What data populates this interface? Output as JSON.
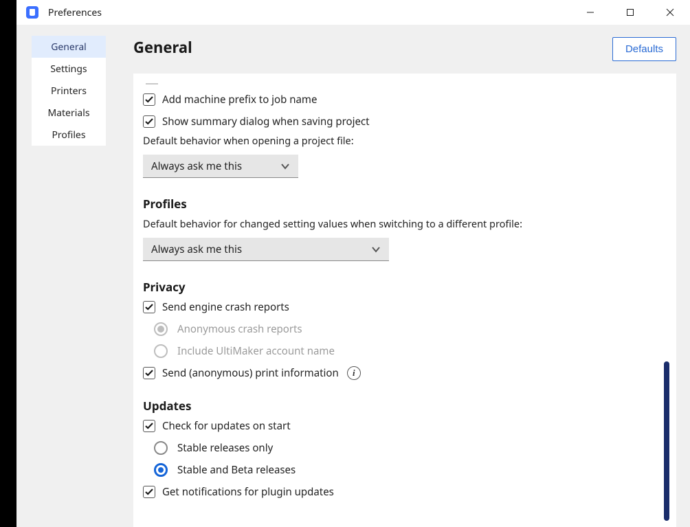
{
  "window": {
    "title": "Preferences"
  },
  "sidebar": {
    "items": [
      {
        "label": "General"
      },
      {
        "label": "Settings"
      },
      {
        "label": "Printers"
      },
      {
        "label": "Materials"
      },
      {
        "label": "Profiles"
      }
    ]
  },
  "header": {
    "page_title": "General",
    "defaults_button": "Defaults"
  },
  "general": {
    "add_prefix": "Add machine prefix to job name",
    "show_summary": "Show summary dialog when saving project",
    "open_behavior_label": "Default behavior when opening a project file:",
    "open_behavior_value": "Always ask me this"
  },
  "profiles": {
    "title": "Profiles",
    "switch_label": "Default behavior for changed setting values when switching to a different profile:",
    "switch_value": "Always ask me this"
  },
  "privacy": {
    "title": "Privacy",
    "crash_reports": "Send engine crash reports",
    "anon_crash": "Anonymous crash reports",
    "include_account": "Include UltiMaker account name",
    "print_info": "Send (anonymous) print information"
  },
  "updates": {
    "title": "Updates",
    "check_on_start": "Check for updates on start",
    "stable_only": "Stable releases only",
    "stable_beta": "Stable and Beta releases",
    "plugin_updates": "Get notifications for plugin updates"
  }
}
